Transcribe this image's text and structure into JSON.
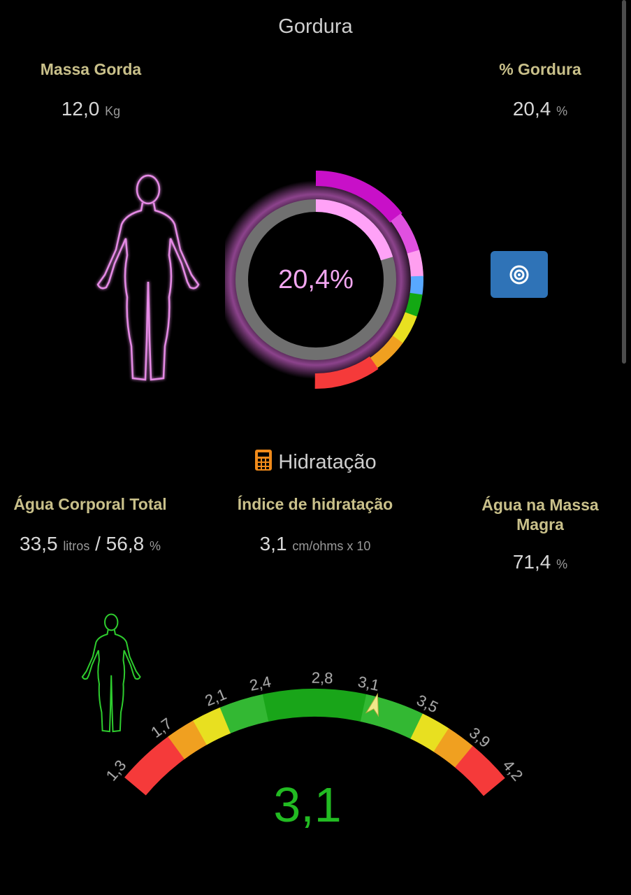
{
  "fat": {
    "title": "Gordura",
    "fat_mass": {
      "label": "Massa Gorda",
      "value": "12,0",
      "unit": "Kg"
    },
    "fat_percent": {
      "label": "% Gordura",
      "value": "20,4",
      "unit": "%"
    },
    "donut_value_text": "20,4%",
    "donut_percent": 20.4
  },
  "hydration": {
    "title": "Hidratação",
    "total_water": {
      "label": "Água Corporal Total",
      "liters": "33,5",
      "liters_unit": "litros",
      "separator": "/",
      "percent": "56,8",
      "percent_unit": "%"
    },
    "hydration_index": {
      "label": "Índice de hidratação",
      "value": "3,1",
      "unit": "cm/ohms x 10"
    },
    "water_lean_mass": {
      "label_line1": "Água na Massa",
      "label_line2": "Magra",
      "value": "71,4",
      "unit": "%"
    },
    "gauge": {
      "value": 3.1,
      "value_text": "3,1",
      "min": 1.3,
      "max": 4.2,
      "ticks": [
        "1,3",
        "1,7",
        "2,1",
        "2,4",
        "2,8",
        "3,1",
        "3,5",
        "3,9",
        "4,2"
      ],
      "tick_values": [
        1.3,
        1.7,
        2.1,
        2.4,
        2.8,
        3.1,
        3.5,
        3.9,
        4.2
      ],
      "zones": [
        {
          "from": 1.3,
          "to": 1.7,
          "color": "#f53a3a"
        },
        {
          "from": 1.7,
          "to": 1.9,
          "color": "#f0a020"
        },
        {
          "from": 1.9,
          "to": 2.1,
          "color": "#e8e020"
        },
        {
          "from": 2.1,
          "to": 2.4,
          "color": "#33b833"
        },
        {
          "from": 2.4,
          "to": 3.1,
          "color": "#19a519"
        },
        {
          "from": 3.1,
          "to": 3.5,
          "color": "#33b833"
        },
        {
          "from": 3.5,
          "to": 3.7,
          "color": "#e8e020"
        },
        {
          "from": 3.7,
          "to": 3.9,
          "color": "#f0a020"
        },
        {
          "from": 3.9,
          "to": 4.2,
          "color": "#f53a3a"
        }
      ]
    }
  },
  "colors": {
    "accent_gold": "#c9c08a",
    "fat_pink": "#ff9ff5",
    "magenta": "#c810c8",
    "gauge_green": "#22bb22",
    "button_blue": "#2f73b7",
    "calc_orange": "#f08a1a"
  },
  "icons": {
    "female_silhouette_pink": "female-body-outline",
    "female_silhouette_green": "female-body-outline",
    "target": "target-icon",
    "calculator": "calculator-icon"
  }
}
